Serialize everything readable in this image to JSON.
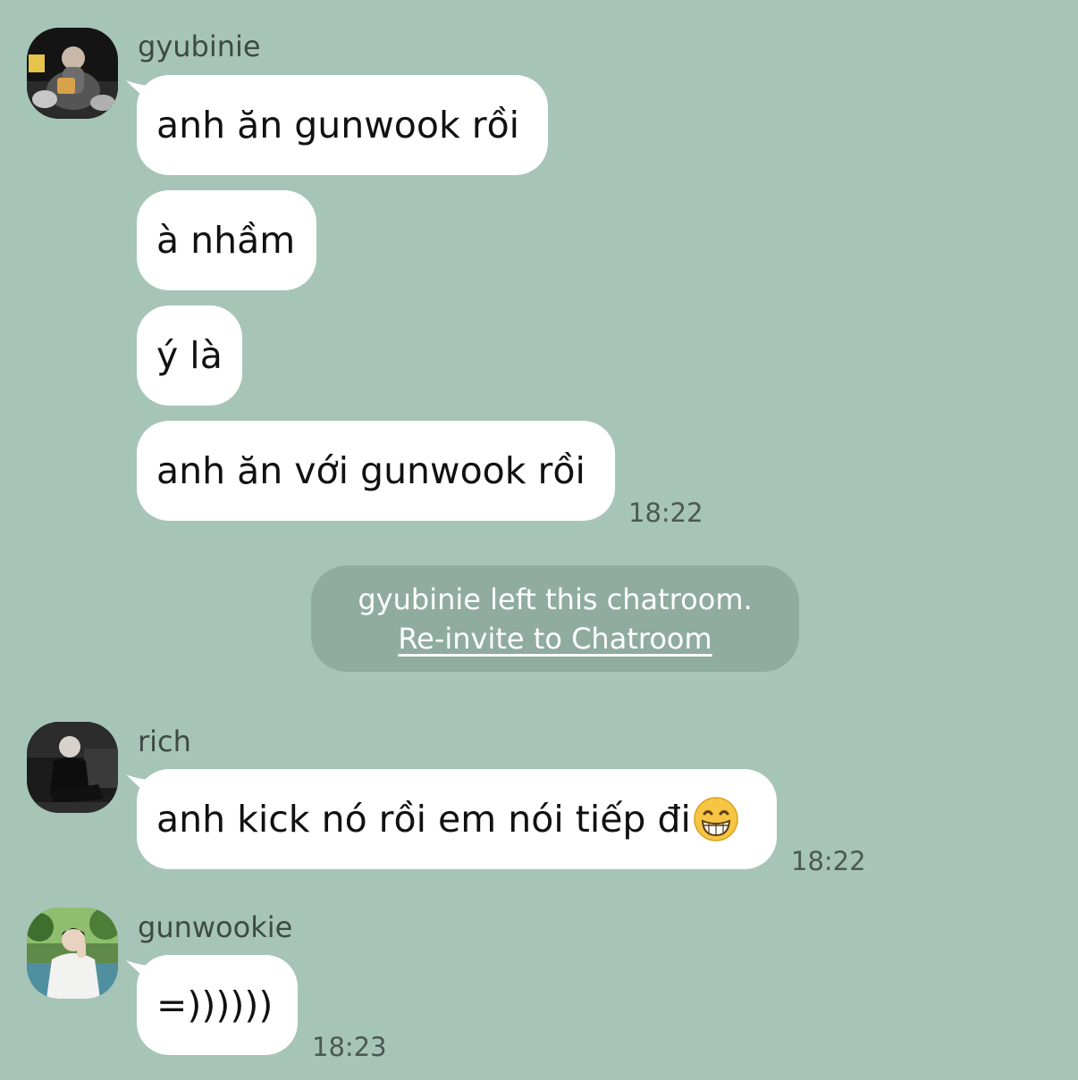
{
  "messages": {
    "gyubinie": {
      "name": "gyubinie",
      "bubbles": [
        "anh ăn gunwook rồi",
        "à nhầm",
        "ý là",
        "anh ăn với gunwook rồi"
      ],
      "time": "18:22"
    },
    "system": {
      "text": "gyubinie left this chatroom.",
      "link": "Re-invite to Chatroom"
    },
    "rich": {
      "name": "rich",
      "bubble": "anh kick nó rồi em nói tiếp đi",
      "emoji": "grinning-face-with-smiling-eyes",
      "time": "18:22"
    },
    "gunwookie": {
      "name": "gunwookie",
      "bubble": "=))))))",
      "time": "18:23"
    }
  },
  "colors": {
    "background": "#a7c5b7",
    "bubble": "#ffffff",
    "system_pill": "#8fac9f"
  }
}
